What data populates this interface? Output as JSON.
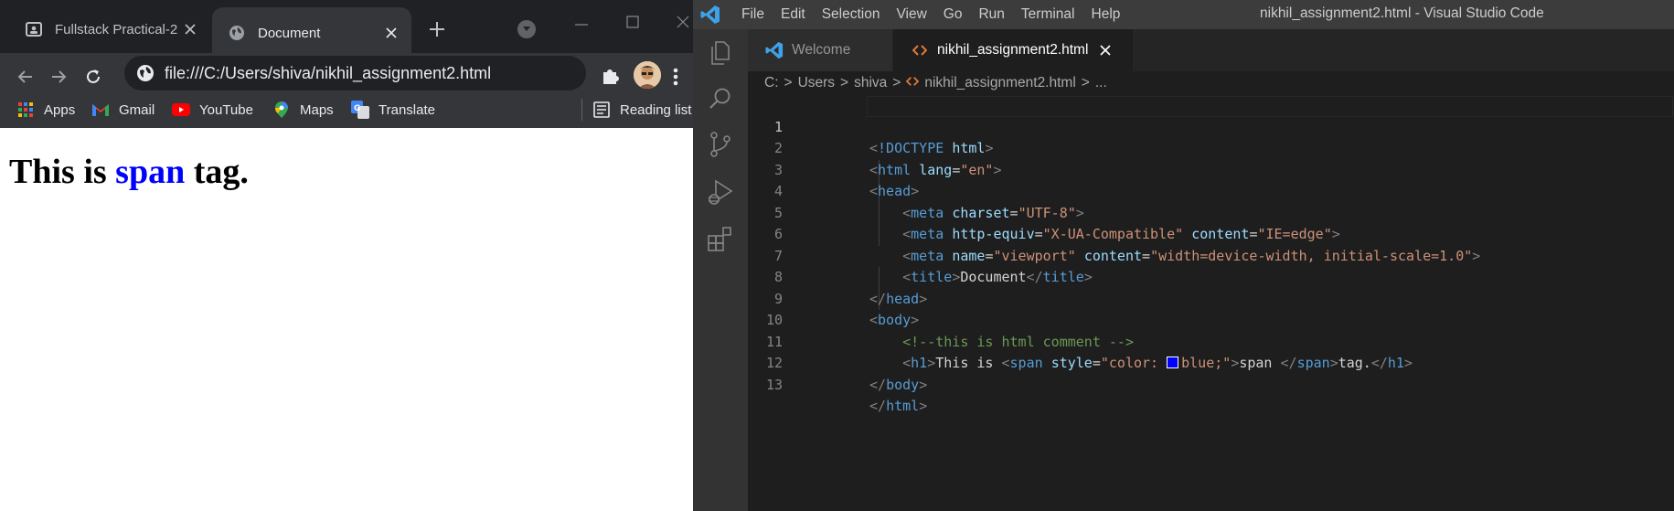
{
  "chrome": {
    "tabs": [
      {
        "title": "Fullstack Practical-2",
        "icon": "classroom-icon"
      },
      {
        "title": "Document",
        "icon": "globe-icon"
      }
    ],
    "url": "file:///C:/Users/shiva/nikhil_assignment2.html",
    "bookmarks": [
      {
        "label": "Apps",
        "icon": "apps-grid-icon"
      },
      {
        "label": "Gmail",
        "icon": "gmail-icon"
      },
      {
        "label": "YouTube",
        "icon": "youtube-icon"
      },
      {
        "label": "Maps",
        "icon": "maps-icon"
      },
      {
        "label": "Translate",
        "icon": "translate-icon"
      },
      {
        "label": "Reading list",
        "icon": "reading-list-icon"
      }
    ],
    "page": {
      "before": "This is ",
      "span": "span",
      "after": " tag.",
      "span_color": "#0000ff"
    }
  },
  "vscode": {
    "menu": [
      "File",
      "Edit",
      "Selection",
      "View",
      "Go",
      "Run",
      "Terminal",
      "Help"
    ],
    "window_title": "nikhil_assignment2.html - Visual Studio Code",
    "tabs": [
      {
        "label": "Welcome",
        "icon": "vscode-icon"
      },
      {
        "label": "nikhil_assignment2.html",
        "icon": "html-file-icon"
      }
    ],
    "breadcrumb": [
      "C:",
      "Users",
      "shiva",
      "nikhil_assignment2.html",
      "..."
    ],
    "line_numbers": [
      "1",
      "2",
      "3",
      "4",
      "5",
      "6",
      "7",
      "8",
      "9",
      "10",
      "11",
      "12",
      "13"
    ],
    "code": {
      "l1": {
        "open": "<",
        "doctype": "!DOCTYPE",
        "html": "html",
        "close": ">"
      },
      "l2": {
        "tag": "html",
        "attr": "lang",
        "val": "\"en\""
      },
      "l3": {
        "tag": "head"
      },
      "l4": {
        "tag": "meta",
        "attr": "charset",
        "val": "\"UTF-8\""
      },
      "l5": {
        "tag": "meta",
        "attr1": "http-equiv",
        "val1": "\"X-UA-Compatible\"",
        "attr2": "content",
        "val2": "\"IE=edge\""
      },
      "l6": {
        "tag": "meta",
        "attr1": "name",
        "val1": "\"viewport\"",
        "attr2": "content",
        "val2": "\"width=device-width, initial-scale=1.0\""
      },
      "l7": {
        "tag": "title",
        "text": "Document"
      },
      "l8": {
        "tag": "head"
      },
      "l9": {
        "tag": "body"
      },
      "l10": {
        "comment": "<!--this is html comment -->"
      },
      "l11": {
        "h1": "h1",
        "text1": "This is ",
        "span": "span",
        "attr": "style",
        "val_a": "\"color: ",
        "val_b": "blue;\"",
        "text2": "span ",
        "text3": "tag."
      },
      "l12": {
        "tag": "body"
      },
      "l13": {
        "tag": "html"
      }
    }
  }
}
